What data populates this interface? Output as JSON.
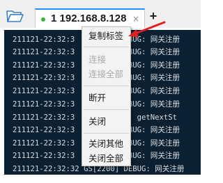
{
  "tab": {
    "label": "1 192.168.8.128",
    "close_glyph": "×",
    "status_color": "#3cb43c"
  },
  "add_tab_glyph": "+",
  "icons": {
    "open_folder": "folder-open-icon",
    "status_dot": "connected-dot-icon"
  },
  "colors": {
    "terminal_bg": "#0b2030",
    "annotation_arrow": "#e02020"
  },
  "log_lines": [
    {
      "left": "211121-22:32:3",
      "right": "DEBUG: 网关注册"
    },
    {
      "left": "211121-22:32:3",
      "right": "DEBUG: 网关注册"
    },
    {
      "left": "211121-22:32:3",
      "right": "DEBUG: 网关注册"
    },
    {
      "left": "211121-22:32:3",
      "right": "DEBUG: 网关注册"
    },
    {
      "left": "211121-22:32:3",
      "right": "DEBUG: 网关注册"
    },
    {
      "left": "211121-22:32:3",
      "right": "DEBUG: 网关注册"
    },
    {
      "left": "211121-22:32:3",
      "right": "DEBUG: 网关注册"
    },
    {
      "left": "211121-22:32:3",
      "right": "DEBUG: 网关注册"
    },
    {
      "left": "211121-22:32:3",
      "right": "UG: getNextSt"
    },
    {
      "left": "211121-22:32:3",
      "right": "DEBUG: 网关注册"
    },
    {
      "left": "211121-22:32:3",
      "right": "DEBUG: 网关注册"
    },
    {
      "left": "211121-22:32:3",
      "right": "DEBUG: 网关注册"
    },
    {
      "left": "211121-22:32:32",
      "right": "GS[2200] DEBUG: 网关注册"
    }
  ],
  "context_menu": {
    "copy_tab": "复制标签",
    "connect": "连接",
    "connect_all": "连接全部",
    "disconnect": "断开",
    "close": "关闭",
    "close_others": "关闭其他",
    "close_all": "关闭全部"
  }
}
